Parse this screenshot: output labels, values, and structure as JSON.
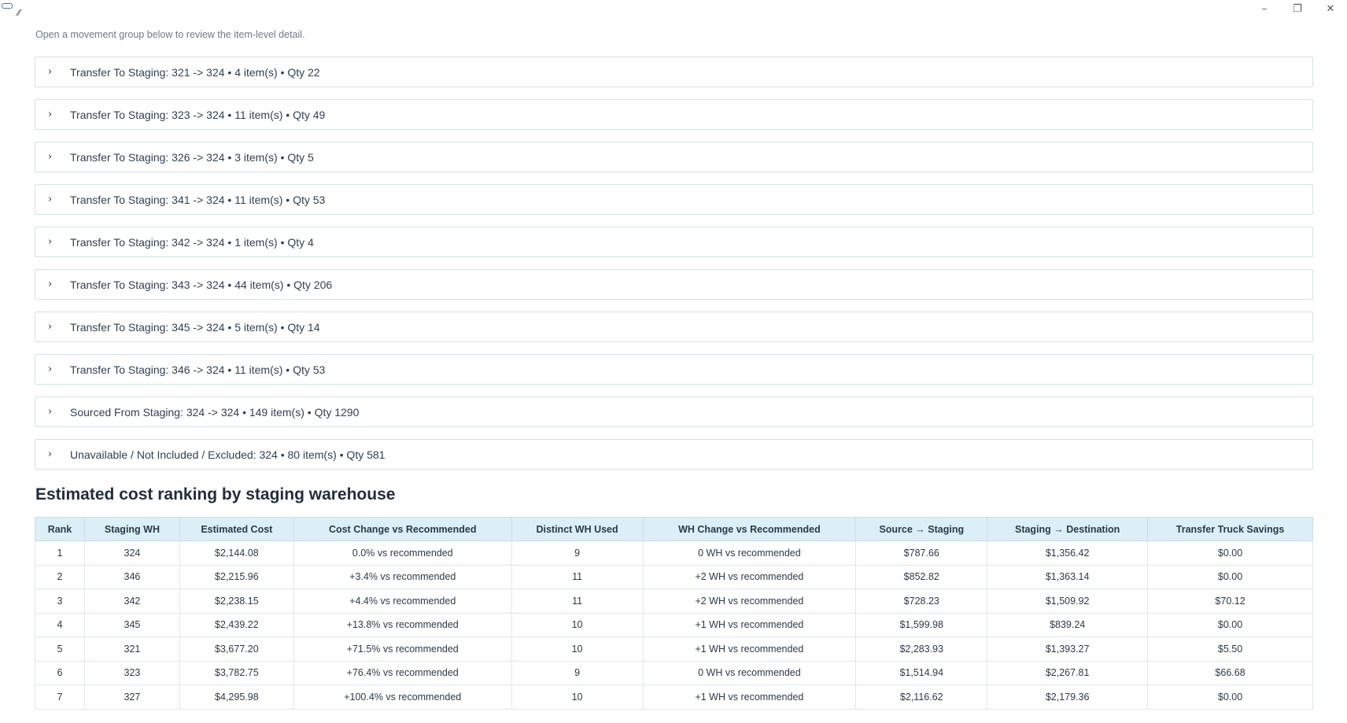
{
  "intro": "Open a movement group below to review the item-level detail.",
  "groups": [
    {
      "label": "Transfer To Staging: 321 -> 324 • 4 item(s) • Qty 22"
    },
    {
      "label": "Transfer To Staging: 323 -> 324 • 11 item(s) • Qty 49"
    },
    {
      "label": "Transfer To Staging: 326 -> 324 • 3 item(s) • Qty 5"
    },
    {
      "label": "Transfer To Staging: 341 -> 324 • 11 item(s) • Qty 53"
    },
    {
      "label": "Transfer To Staging: 342 -> 324 • 1 item(s) • Qty 4"
    },
    {
      "label": "Transfer To Staging: 343 -> 324 • 44 item(s) • Qty 206"
    },
    {
      "label": "Transfer To Staging: 345 -> 324 • 5 item(s) • Qty 14"
    },
    {
      "label": "Transfer To Staging: 346 -> 324 • 11 item(s) • Qty 53"
    },
    {
      "label": "Sourced From Staging: 324 -> 324 • 149 item(s) • Qty 1290"
    },
    {
      "label": "Unavailable / Not Included / Excluded: 324 • 80 item(s) • Qty 581"
    }
  ],
  "ranking": {
    "title": "Estimated cost ranking by staging warehouse",
    "columns": [
      "Rank",
      "Staging WH",
      "Estimated Cost",
      "Cost Change vs Recommended",
      "Distinct WH Used",
      "WH Change vs Recommended",
      "Source → Staging",
      "Staging → Destination",
      "Transfer Truck Savings"
    ],
    "rows": [
      [
        "1",
        "324",
        "$2,144.08",
        "0.0% vs recommended",
        "9",
        "0 WH vs recommended",
        "$787.66",
        "$1,356.42",
        "$0.00"
      ],
      [
        "2",
        "346",
        "$2,215.96",
        "+3.4% vs recommended",
        "11",
        "+2 WH vs recommended",
        "$852.82",
        "$1,363.14",
        "$0.00"
      ],
      [
        "3",
        "342",
        "$2,238.15",
        "+4.4% vs recommended",
        "11",
        "+2 WH vs recommended",
        "$728.23",
        "$1,509.92",
        "$70.12"
      ],
      [
        "4",
        "345",
        "$2,439.22",
        "+13.8% vs recommended",
        "10",
        "+1 WH vs recommended",
        "$1,599.98",
        "$839.24",
        "$0.00"
      ],
      [
        "5",
        "321",
        "$3,677.20",
        "+71.5% vs recommended",
        "10",
        "+1 WH vs recommended",
        "$2,283.93",
        "$1,393.27",
        "$5.50"
      ],
      [
        "6",
        "323",
        "$3,782.75",
        "+76.4% vs recommended",
        "9",
        "0 WH vs recommended",
        "$1,514.94",
        "$2,267.81",
        "$66.68"
      ],
      [
        "7",
        "327",
        "$4,295.98",
        "+100.4% vs recommended",
        "10",
        "+1 WH vs recommended",
        "$2,116.62",
        "$2,179.36",
        "$0.00"
      ]
    ]
  }
}
